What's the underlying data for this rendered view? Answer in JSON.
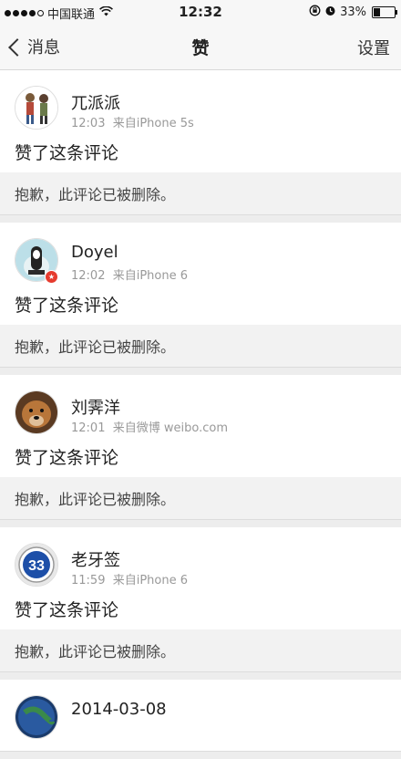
{
  "status": {
    "carrier": "中国联通",
    "time": "12:32",
    "battery": "33%",
    "battery_level": 0.33
  },
  "nav": {
    "back_label": "消息",
    "title": "赞",
    "right_label": "设置"
  },
  "likes": [
    {
      "name": "兀派派",
      "time": "12:03",
      "source": "来自iPhone 5s",
      "action": "赞了这条评论",
      "quote": "抱歉，此评论已被删除。"
    },
    {
      "name": "Doyel",
      "time": "12:02",
      "source": "来自iPhone 6",
      "action": "赞了这条评论",
      "quote": "抱歉，此评论已被删除。"
    },
    {
      "name": "刘霁洋",
      "time": "12:01",
      "source": "来自微博 weibo.com",
      "action": "赞了这条评论",
      "quote": "抱歉，此评论已被删除。"
    },
    {
      "name": "老牙签",
      "time": "11:59",
      "source": "来自iPhone 6",
      "action": "赞了这条评论",
      "quote": "抱歉，此评论已被删除。"
    },
    {
      "name": "2014-03-08"
    }
  ],
  "colors": {
    "bar_bg": "#f7f7f7",
    "quote_bg": "#f2f2f2",
    "meta_text": "#999999"
  }
}
